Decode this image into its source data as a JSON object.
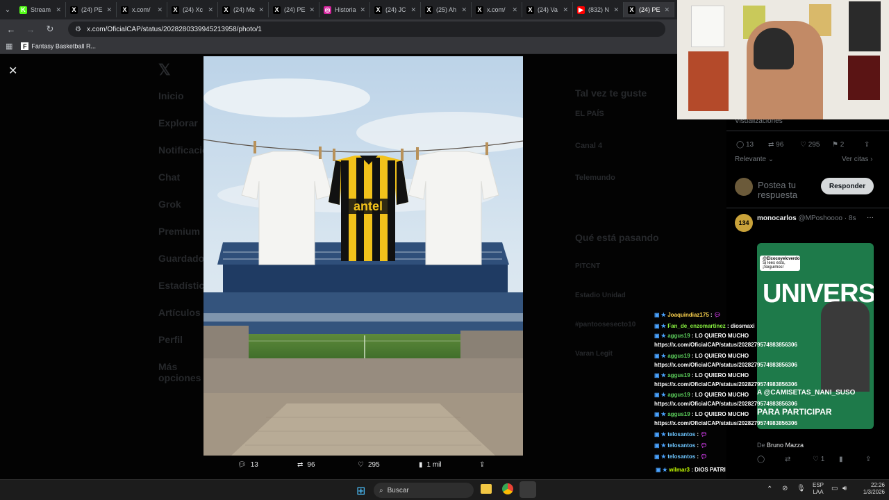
{
  "browser": {
    "tabs": [
      {
        "label": "Stream",
        "fav": "K",
        "color": "#53fc18"
      },
      {
        "label": "(24) PE",
        "fav": "X",
        "color": "#000000"
      },
      {
        "label": "x.com/",
        "fav": "X",
        "color": "#000000"
      },
      {
        "label": "(24) Xc",
        "fav": "X",
        "color": "#000000"
      },
      {
        "label": "(24) Me",
        "fav": "X",
        "color": "#000000"
      },
      {
        "label": "(24) PE",
        "fav": "X",
        "color": "#000000"
      },
      {
        "label": "Historia",
        "fav": "◎",
        "color": "#d6249f"
      },
      {
        "label": "(24) JC",
        "fav": "X",
        "color": "#000000"
      },
      {
        "label": "(25) Ah",
        "fav": "X",
        "color": "#000000"
      },
      {
        "label": "x.com/",
        "fav": "X",
        "color": "#000000"
      },
      {
        "label": "(24) Va",
        "fav": "X",
        "color": "#000000"
      },
      {
        "label": "(832) N",
        "fav": "▶",
        "color": "#ff0000"
      },
      {
        "label": "(24) PE",
        "fav": "X",
        "color": "#000000"
      }
    ],
    "url": "x.com/OficialCAP/status/2028280339945213958/photo/1",
    "bookmark": "Fantasy Basketball R..."
  },
  "bg_sidebar": [
    "Inicio",
    "Explorar",
    "Notificaciones",
    "Chat",
    "Grok",
    "Premium",
    "Guardados",
    "Estadísticas",
    "Artículos",
    "Perfil",
    "Más opciones"
  ],
  "bg_right": {
    "title": "Tal vez te guste",
    "accounts": [
      "EL PAÍS",
      "Canal 4",
      "Telemundo"
    ],
    "trending_title": "Qué está pasando",
    "trends": [
      "PITCNT",
      "Estadio Unidad",
      "#pantoosesecto10",
      "Varan Legit"
    ]
  },
  "actions": {
    "replies": "13",
    "reposts": "96",
    "likes": "295",
    "views": "1 mil"
  },
  "tweet": {
    "views_label": "Visualizaciones",
    "replies": "13",
    "reposts": "96",
    "likes": "295",
    "bookmarks": "2",
    "sort": "Relevante",
    "quotes": "Ver citas",
    "compose": "Postea tu respuesta",
    "reply_button": "Responder"
  },
  "reply": {
    "name": "monocarlos",
    "handle": "@MPoshoooo · 8s",
    "video_caption_top": "@Elcocoyelcverdo",
    "video_caption_sub": "Si lees esto, ¡Seguimos!",
    "video_big": "UNIVERS",
    "video_tag": "A @CAMISETAS_NANI_SUSO",
    "video_cta": "PARA PARTICIPAR",
    "from_label": "De",
    "from_name": "Bruno Mazza",
    "likes": "1"
  },
  "chat": [
    {
      "user": "Joaquindiaz175",
      "msg": "",
      "color": "#ffd54f"
    },
    {
      "user": "Fan_de_enzomartinez",
      "msg": "diosmaxi",
      "color": "#8bf542"
    },
    {
      "user": "aggus19",
      "msg": "LO QUIERO MUCHO",
      "color": "#5ccf5c"
    },
    {
      "user": "",
      "msg": "https://x.com/OficialCAP/status/2028279574983856306",
      "color": "#ffffff"
    },
    {
      "user": "aggus19",
      "msg": "LO QUIERO MUCHO",
      "color": "#5ccf5c"
    },
    {
      "user": "",
      "msg": "https://x.com/OficialCAP/status/2028279574983856306",
      "color": "#ffffff"
    },
    {
      "user": "aggus19",
      "msg": "LO QUIERO MUCHO",
      "color": "#5ccf5c"
    },
    {
      "user": "",
      "msg": "https://x.com/OficialCAP/status/2028279574983856306",
      "color": "#ffffff"
    },
    {
      "user": "aggus19",
      "msg": "LO QUIERO MUCHO",
      "color": "#5ccf5c"
    },
    {
      "user": "",
      "msg": "https://x.com/OficialCAP/status/2028279574983856306",
      "color": "#ffffff"
    },
    {
      "user": "aggus19",
      "msg": "LO QUIERO MUCHO",
      "color": "#5ccf5c"
    },
    {
      "user": "",
      "msg": "https://x.com/OficialCAP/status/2028279574983856306",
      "color": "#ffffff"
    },
    {
      "user": "telosantos",
      "msg": "",
      "color": "#6ec6ff"
    },
    {
      "user": "telosantos",
      "msg": "",
      "color": "#6ec6ff"
    },
    {
      "user": "telosantos",
      "msg": "",
      "color": "#6ec6ff"
    },
    {
      "user": "wilmar3",
      "msg": "DIOS PATRI",
      "color": "#c6ff00"
    }
  ],
  "jersey": {
    "sponsor": "antel"
  },
  "taskbar": {
    "search": "Buscar",
    "lang": "ESP",
    "layout": "LAA",
    "time": "22:26",
    "date": "1/3/2026"
  }
}
